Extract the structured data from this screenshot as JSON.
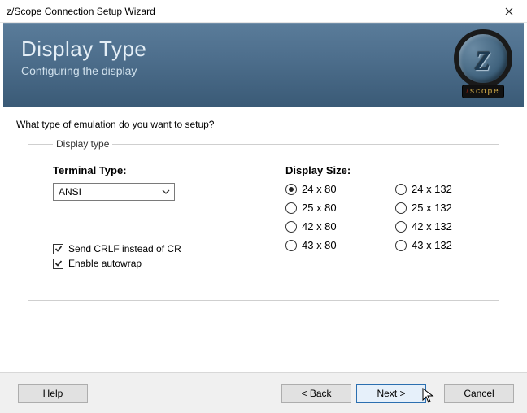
{
  "window": {
    "title": "z/Scope Connection Setup Wizard"
  },
  "banner": {
    "title": "Display Type",
    "subtitle": "Configuring the display",
    "logo_letter": "z",
    "logo_tag_prefix": "/",
    "logo_tag_rest": "scope"
  },
  "prompt": "What type of emulation do you want to setup?",
  "group_legend": "Display type",
  "terminal": {
    "label": "Terminal Type:",
    "value": "ANSI"
  },
  "checks": {
    "crlf": {
      "label": "Send CRLF instead of CR",
      "checked": true
    },
    "autowrap": {
      "label": "Enable autowrap",
      "checked": true
    }
  },
  "display_size": {
    "label": "Display Size:",
    "options": [
      {
        "label": "24 x 80",
        "selected": true
      },
      {
        "label": "24 x 132",
        "selected": false
      },
      {
        "label": "25 x 80",
        "selected": false
      },
      {
        "label": "25 x 132",
        "selected": false
      },
      {
        "label": "42 x 80",
        "selected": false
      },
      {
        "label": "42 x 132",
        "selected": false
      },
      {
        "label": "43 x 80",
        "selected": false
      },
      {
        "label": "43 x 132",
        "selected": false
      }
    ]
  },
  "buttons": {
    "help": "Help",
    "back": "< Back",
    "next_prefix": "N",
    "next_rest": "ext >",
    "cancel": "Cancel"
  }
}
